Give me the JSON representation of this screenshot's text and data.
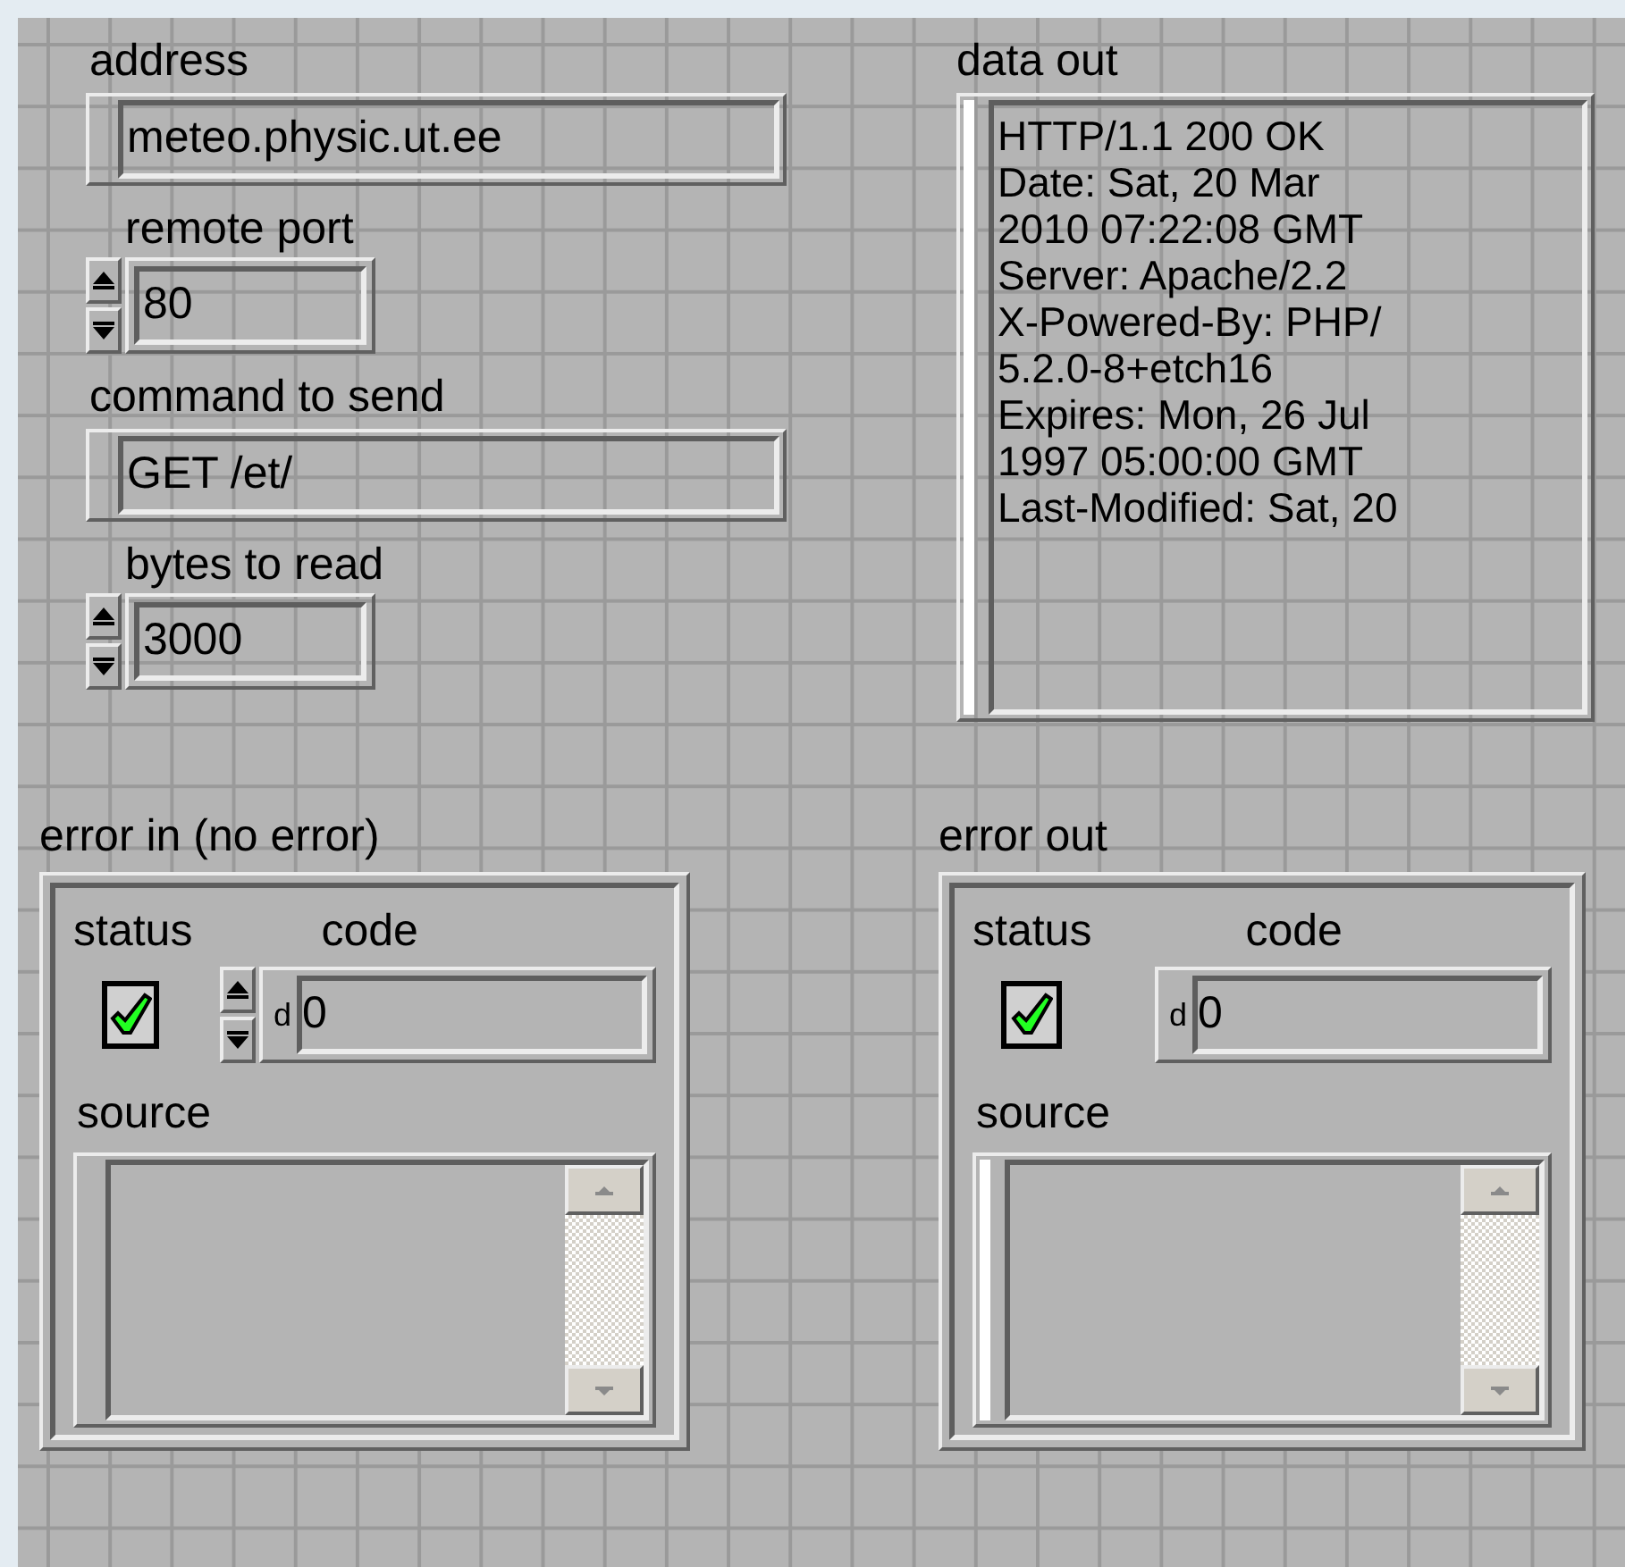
{
  "controls": [
    {
      "label": "address",
      "kind": "string",
      "value": "meteo.physic.ut.ee"
    },
    {
      "label": "remote port",
      "kind": "numeric",
      "value": "80"
    },
    {
      "label": "command to send",
      "kind": "string",
      "value": "GET /et/"
    },
    {
      "label": "bytes to read",
      "kind": "numeric",
      "value": "3000"
    }
  ],
  "data_out": {
    "label": "data out",
    "lines": [
      "HTTP/1.1 200 OK",
      "Date: Sat, 20 Mar",
      "2010 07:22:08 GMT",
      "Server: Apache/2.2",
      "X-Powered-By: PHP/",
      "5.2.0-8+etch16",
      "Expires: Mon, 26 Jul",
      "1997 05:00:00 GMT",
      "Last-Modified: Sat, 20"
    ]
  },
  "clusters": [
    {
      "label": "error in (no error)",
      "kind": "control",
      "status_label": "status",
      "checked": true,
      "code_label": "code",
      "radix": "d",
      "code": "0",
      "source_label": "source"
    },
    {
      "label": "error out",
      "kind": "indicator",
      "status_label": "status",
      "checked": true,
      "code_label": "code",
      "radix": "d",
      "code": "0",
      "source_label": "source"
    }
  ]
}
